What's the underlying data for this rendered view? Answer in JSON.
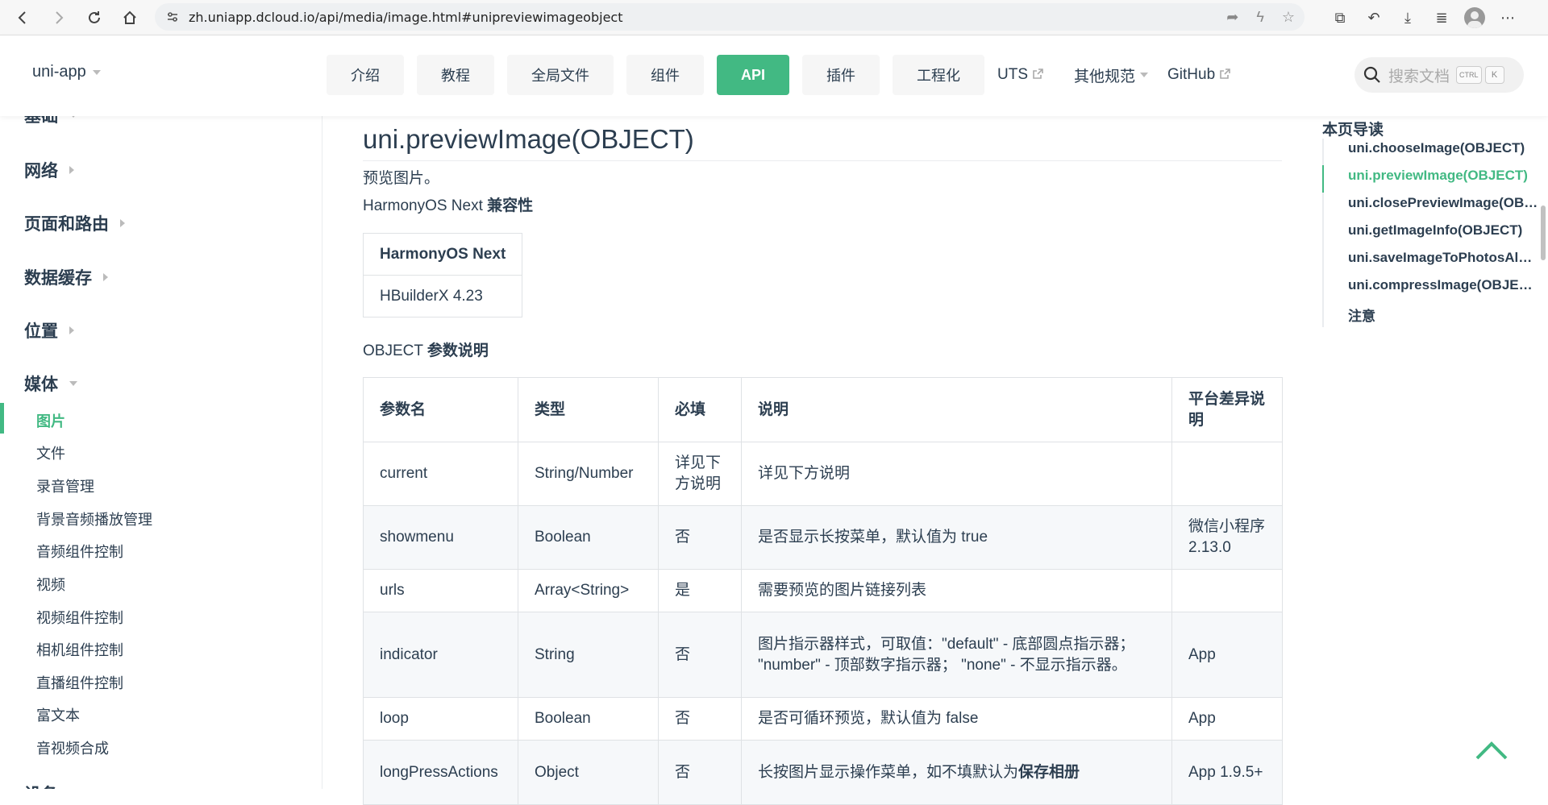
{
  "browser": {
    "url": "zh.uniapp.dcloud.io/api/media/image.html#unipreviewimageobject"
  },
  "header": {
    "logo": "uni-app",
    "tabs": [
      {
        "label": "介绍"
      },
      {
        "label": "教程"
      },
      {
        "label": "全局文件"
      },
      {
        "label": "组件"
      },
      {
        "label": "API",
        "active": true
      },
      {
        "label": "插件"
      },
      {
        "label": "工程化"
      }
    ],
    "links": {
      "uts": "UTS",
      "other": "其他规范",
      "github": "GitHub"
    },
    "search_placeholder": "搜索文档",
    "kbd_ctrl": "CTRL",
    "kbd_k": "K"
  },
  "sidebar": {
    "partial_top": "基础",
    "groups": [
      "网络",
      "页面和路由",
      "数据缓存",
      "位置",
      "媒体"
    ],
    "items": [
      "图片",
      "文件",
      "录音管理",
      "背景音频播放管理",
      "音频组件控制",
      "视频",
      "视频组件控制",
      "相机组件控制",
      "直播组件控制",
      "富文本",
      "音视频合成"
    ],
    "partial_bottom": "设备"
  },
  "main": {
    "title": "uni.previewImage(OBJECT)",
    "desc": "预览图片。",
    "compat_heading_prefix": "HarmonyOS Next ",
    "compat_heading_bold": "兼容性",
    "compat_table": {
      "header": "HarmonyOS Next",
      "value": "HBuilderX 4.23"
    },
    "object_heading_prefix": "OBJECT ",
    "object_heading_bold": "参数说明",
    "param_table": {
      "headers": [
        "参数名",
        "类型",
        "必填",
        "说明",
        "平台差异说明"
      ],
      "rows": [
        [
          "current",
          "String/Number",
          "详见下方说明",
          "详见下方说明",
          ""
        ],
        [
          "showmenu",
          "Boolean",
          "否",
          "是否显示长按菜单，默认值为 true",
          "微信小程序2.13.0"
        ],
        [
          "urls",
          "Array<String>",
          "是",
          "需要预览的图片链接列表",
          ""
        ],
        [
          "indicator",
          "String",
          "否",
          "图片指示器样式，可取值：\"default\" - 底部圆点指示器； \"number\" - 顶部数字指示器； \"none\" - 不显示指示器。",
          "App"
        ],
        [
          "loop",
          "Boolean",
          "否",
          "是否可循环预览，默认值为 false",
          "App"
        ],
        [
          "longPressActions",
          "Object",
          "否",
          "长按图片显示操作菜单，如不填默认为",
          "App 1.9.5+"
        ]
      ],
      "last_desc_bold": "保存相册"
    }
  },
  "toc": {
    "heading": "本页导读",
    "items": [
      "uni.chooseImage(OBJECT)",
      "uni.previewImage(OBJECT)",
      "uni.closePreviewImage(OBJECT)",
      "uni.getImageInfo(OBJECT)",
      "uni.saveImageToPhotosAlbum(OBJECT)",
      "uni.compressImage(OBJECT)",
      "注意"
    ]
  },
  "colors": {
    "accent": "#42b983",
    "text": "#2c3e50"
  }
}
